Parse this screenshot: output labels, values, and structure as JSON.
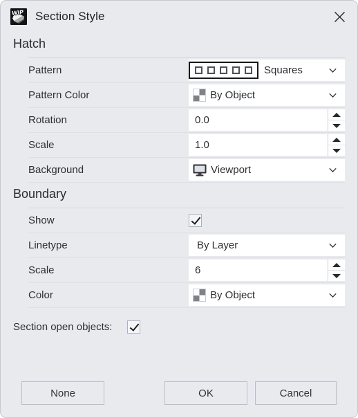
{
  "window": {
    "title": "Section Style",
    "app_icon": "wip-glove-icon",
    "icon_badge_text": "WIP",
    "close_icon": "close-icon"
  },
  "sections": [
    {
      "title": "Hatch",
      "rows": [
        {
          "label": "Pattern",
          "control": "combo-pattern",
          "value": "Squares",
          "icon": "pattern-squares-swatch"
        },
        {
          "label": "Pattern Color",
          "control": "combo",
          "value": "By Object",
          "icon": "color-checker-swatch"
        },
        {
          "label": "Rotation",
          "control": "spin",
          "value": "0.0",
          "icon": ""
        },
        {
          "label": "Scale",
          "control": "spin",
          "value": "1.0",
          "icon": ""
        },
        {
          "label": "Background",
          "control": "combo",
          "value": "Viewport",
          "icon": "monitor-icon"
        }
      ]
    },
    {
      "title": "Boundary",
      "rows": [
        {
          "label": "Show",
          "control": "checkbox",
          "value": "",
          "checked": true,
          "icon": ""
        },
        {
          "label": "Linetype",
          "control": "combo",
          "value": "By Layer",
          "icon": ""
        },
        {
          "label": "Scale",
          "control": "spin",
          "value": "6",
          "icon": ""
        },
        {
          "label": "Color",
          "control": "combo",
          "value": "By Object",
          "icon": "color-checker-swatch"
        }
      ]
    }
  ],
  "section_open_objects": {
    "label": "Section open objects:",
    "checked": true
  },
  "footer": {
    "none_label": "None",
    "ok_label": "OK",
    "cancel_label": "Cancel"
  },
  "colors": {
    "dialog_background": "#e8eaee",
    "field_background": "#ffffff",
    "text": "#2c2f33",
    "separator": "#dde0e6",
    "button_border": "#b6bfcd",
    "swatch_gray": "#7e8287"
  }
}
